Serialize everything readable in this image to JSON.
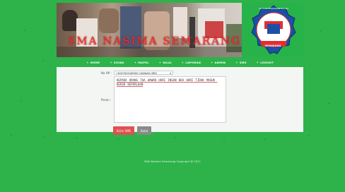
{
  "site": {
    "title": "SMA NASIMA SEMARANG",
    "logo_text_top": "YAYASAN PENDIDIKAN NASIMA",
    "logo_text_bottom": "SEMARANG"
  },
  "nav": {
    "items": [
      {
        "label": "HOME"
      },
      {
        "label": "SISWA"
      },
      {
        "label": "MAPEL"
      },
      {
        "label": "NILAI"
      },
      {
        "label": "LAPORAN"
      },
      {
        "label": "ADMIN"
      },
      {
        "label": "SMS"
      },
      {
        "label": "LOGOUT"
      }
    ]
  },
  "form": {
    "phone_label": "No HP :",
    "phone_value": "+6287829069982 (WAWAN HRB)",
    "message_label": "Pesan :",
    "message_value": "KEPADA ORANG TUA WAWAN HARI INGAN HDA HARI TIDAK MASUK KERIN KEPERLUAN",
    "send_label": "Kirim SMS",
    "cancel_label": "Batal"
  },
  "footer": {
    "text": "SMA Nasima Semarang Copyright @ 2011"
  },
  "colors": {
    "background": "#2db34a",
    "send_button": "#e05050",
    "cancel_button": "#8a8a8a"
  }
}
